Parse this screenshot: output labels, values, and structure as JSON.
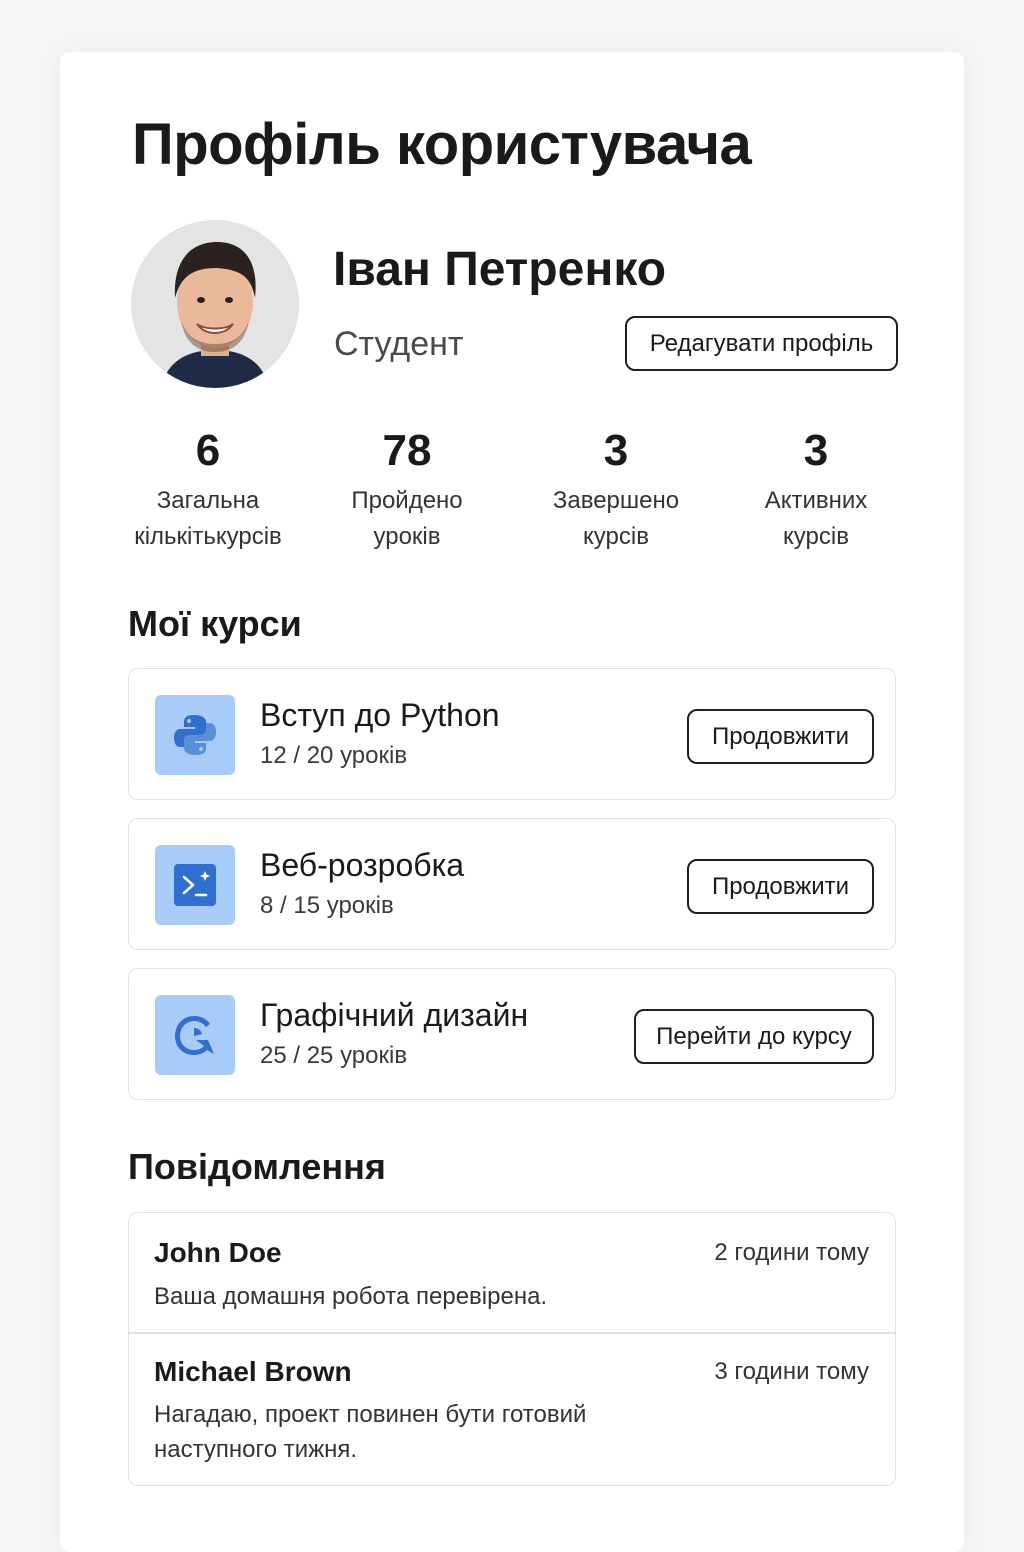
{
  "page": {
    "title": "Профіль користувача"
  },
  "profile": {
    "name": "Іван Петренко",
    "role": "Студент",
    "edit_label": "Редагувати профіль"
  },
  "stats": [
    {
      "value": "6",
      "label": "Загальна\nкількітькурсів"
    },
    {
      "value": "78",
      "label": "Пройдено\nуроків"
    },
    {
      "value": "3",
      "label": "Завершено\nкурсів"
    },
    {
      "value": "3",
      "label": "Активних\nкурсів"
    }
  ],
  "courses": {
    "heading": "Мої курси",
    "items": [
      {
        "title": "Вступ до Python",
        "progress": "12 / 20 уроків",
        "action": "Продовжити",
        "icon": "python-icon"
      },
      {
        "title": "Веб-розробка",
        "progress": "8 / 15 уроків",
        "action": "Продовжити",
        "icon": "terminal-icon"
      },
      {
        "title": "Графічний дизайн",
        "progress": "25 / 25 уроків",
        "action": "Перейти до курсу",
        "icon": "design-icon"
      }
    ]
  },
  "notifications": {
    "heading": "Повідомлення",
    "items": [
      {
        "sender": "John Doe",
        "time": "2 години тому",
        "message": "Ваша домашня робота перевірена."
      },
      {
        "sender": "Michael Brown",
        "time": "3 години тому",
        "message": "Нагадаю, проект повинен бути готовий наступного тижня."
      }
    ]
  },
  "colors": {
    "accent": "#2f6fd0",
    "icon_tile": "#a9cbf7"
  }
}
